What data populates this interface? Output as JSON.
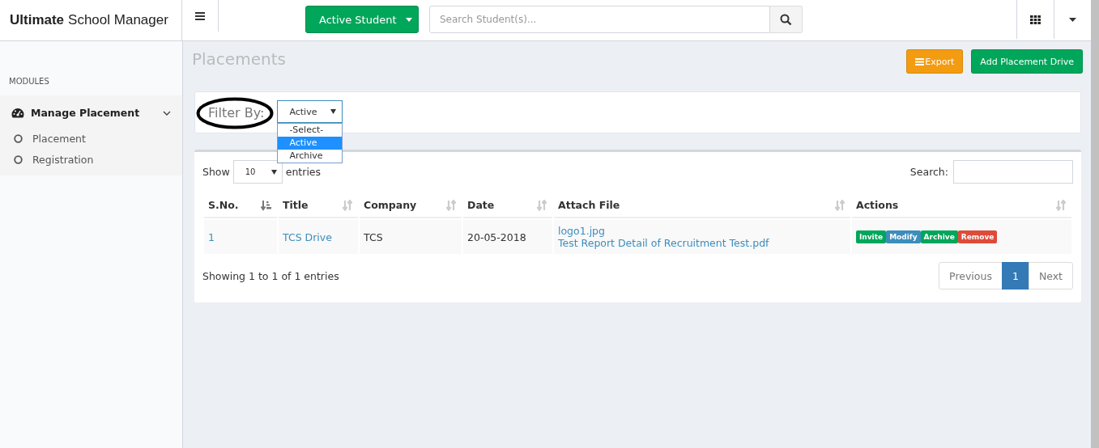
{
  "brand": {
    "bold": "Ultimate",
    "rest": "School Manager"
  },
  "header": {
    "student_button": "Active Student",
    "search_placeholder": "Search Student(s)..."
  },
  "sidebar": {
    "heading": "MODULES",
    "group": {
      "label": "Manage Placement",
      "expanded": true,
      "children": [
        {
          "label": "Placement",
          "selected": false
        },
        {
          "label": "Registration",
          "selected": false
        }
      ]
    }
  },
  "page": {
    "title": "Placements",
    "buttons": [
      {
        "label": "Export",
        "kind": "warning"
      },
      {
        "label": "Add Placement Drive",
        "kind": "success"
      }
    ]
  },
  "filter": {
    "label": "Filter By:",
    "value": "Active",
    "options": [
      {
        "label": "-Select-",
        "selected": false
      },
      {
        "label": "Active",
        "selected": true
      },
      {
        "label": "Archive",
        "selected": false
      }
    ]
  },
  "table": {
    "show_label": "Show",
    "page_size": "10",
    "entries_label": "entries",
    "search_label": "Search:",
    "columns": [
      {
        "label": "S.No.",
        "sorted": true
      },
      {
        "label": "Title",
        "sorted": false
      },
      {
        "label": "Company",
        "sorted": false
      },
      {
        "label": "Date",
        "sorted": false
      },
      {
        "label": "Attach File",
        "sorted": false
      },
      {
        "label": "Actions",
        "sorted": false
      }
    ],
    "rows": [
      {
        "sno": "1",
        "title": "TCS Drive",
        "company": "TCS",
        "date": "20-05-2018",
        "files": [
          "logo1.jpg",
          "Test Report Detail of Recruitment Test.pdf"
        ],
        "actions": [
          {
            "label": "Invite",
            "kind": "success"
          },
          {
            "label": "Modify",
            "kind": "primary"
          },
          {
            "label": "Archive",
            "kind": "success"
          },
          {
            "label": "Remove",
            "kind": "danger"
          }
        ]
      }
    ],
    "info": "Showing 1 to 1 of 1 entries",
    "pagination": [
      {
        "label": "Previous",
        "selected": false
      },
      {
        "label": "1",
        "selected": true
      },
      {
        "label": "Next",
        "selected": false
      }
    ]
  }
}
